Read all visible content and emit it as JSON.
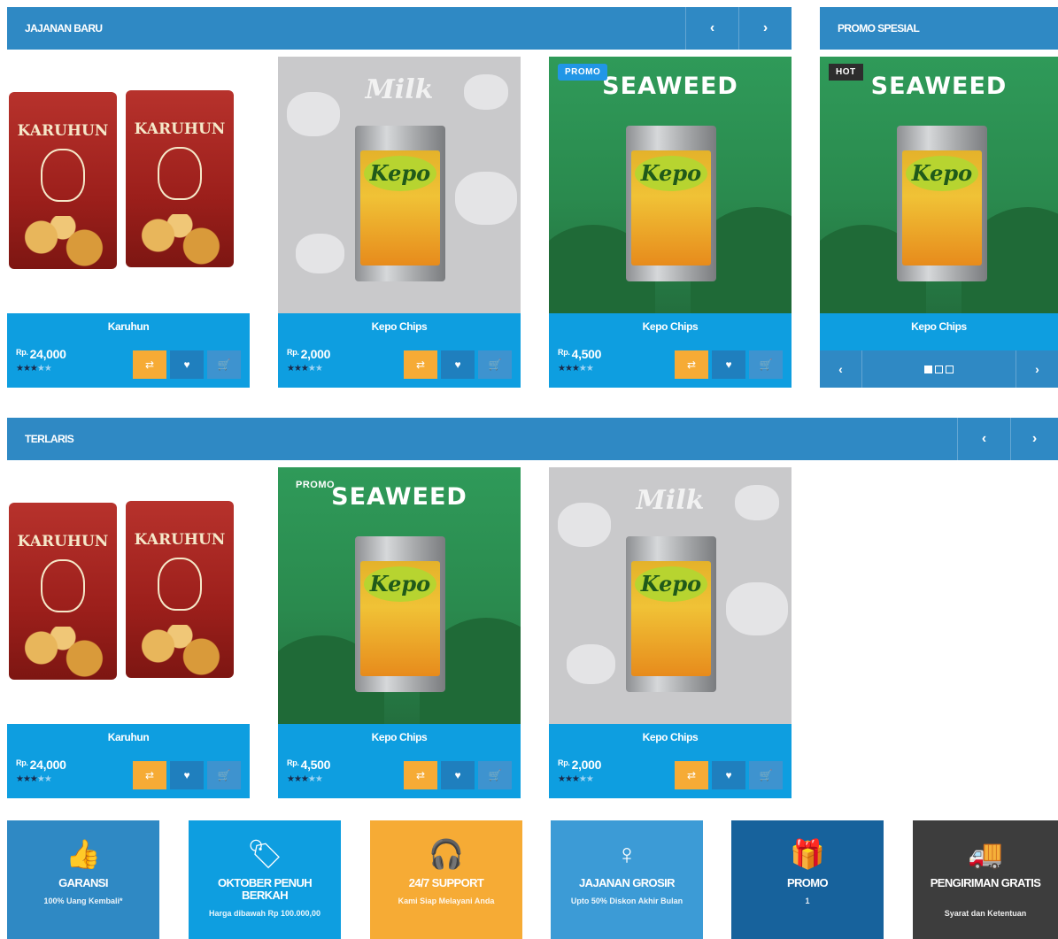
{
  "sections": {
    "new": {
      "title": "JAJANAN BARU",
      "prev": "‹",
      "next": "›"
    },
    "promo": {
      "title": "PROMO SPESIAL"
    },
    "best": {
      "title": "TERLARIS",
      "prev": "‹",
      "next": "›"
    }
  },
  "icons": {
    "compare": "⇄",
    "wishlist": "♥",
    "cart": "🛒"
  },
  "new_products": [
    {
      "name": "Karuhun",
      "currency": "Rp.",
      "price": "24,000",
      "rating": 3,
      "image": "karuhun-chips-bags",
      "bag_brand": "KARUHUN"
    },
    {
      "name": "Kepo Chips",
      "currency": "Rp.",
      "price": "2,000",
      "rating": 3,
      "image": "kepo-chips-milk",
      "scene_title": "Milk",
      "pack_logo": "Kepo"
    },
    {
      "name": "Kepo Chips",
      "currency": "Rp.",
      "price": "4,500",
      "rating": 3,
      "image": "kepo-chips-seaweed",
      "scene_title": "SEAWEED",
      "pack_logo": "Kepo",
      "badge": "PROMO"
    }
  ],
  "promo_product": {
    "name": "Kepo Chips",
    "image": "kepo-chips-seaweed",
    "scene_title": "SEAWEED",
    "pack_logo": "Kepo",
    "badge": "HOT",
    "prev": "‹",
    "next": "›",
    "slide_count": 3,
    "active_slide": 1
  },
  "best_products": [
    {
      "name": "Karuhun",
      "currency": "Rp.",
      "price": "24,000",
      "rating": 3,
      "image": "karuhun-chips-bags",
      "bag_brand": "KARUHUN"
    },
    {
      "name": "Kepo Chips",
      "currency": "Rp.",
      "price": "4,500",
      "rating": 3,
      "image": "kepo-chips-seaweed",
      "scene_title": "SEAWEED",
      "pack_logo": "Kepo",
      "badge": "PROMO"
    },
    {
      "name": "Kepo Chips",
      "currency": "Rp.",
      "price": "2,000",
      "rating": 3,
      "image": "kepo-chips-milk",
      "scene_title": "Milk",
      "pack_logo": "Kepo"
    }
  ],
  "features": [
    {
      "icon": "thumbs-up-icon",
      "title": "GARANSI",
      "subtitle": "100% Uang Kembali*",
      "color": "#2f89c4"
    },
    {
      "icon": "tags-icon",
      "title": "OKTOBER PENUH BERKAH",
      "subtitle": "Harga dibawah Rp 100.000,00",
      "color": "#0e9ee0"
    },
    {
      "icon": "headphones-icon",
      "title": "24/7 SUPPORT",
      "subtitle": "Kami Siap Melayani Anda",
      "color": "#f6ab35"
    },
    {
      "icon": "female-icon",
      "title": "JAJANAN GROSIR",
      "subtitle": "Upto 50% Diskon Akhir Bulan",
      "color": "#3c9bd6"
    },
    {
      "icon": "gift-icon",
      "title": "PROMO",
      "subtitle": "1",
      "color": "#17629c"
    },
    {
      "icon": "truck-icon",
      "title": "PENGIRIMAN GRATIS",
      "subtitle": "Syarat dan Ketentuan",
      "color": "#3d3d3d"
    }
  ],
  "colors": {
    "bar": "#2f89c4",
    "card_info": "#0e9ee0",
    "compare": "#f6ab35",
    "wishlist": "#1f7fbe",
    "cart": "#3e93cf"
  }
}
